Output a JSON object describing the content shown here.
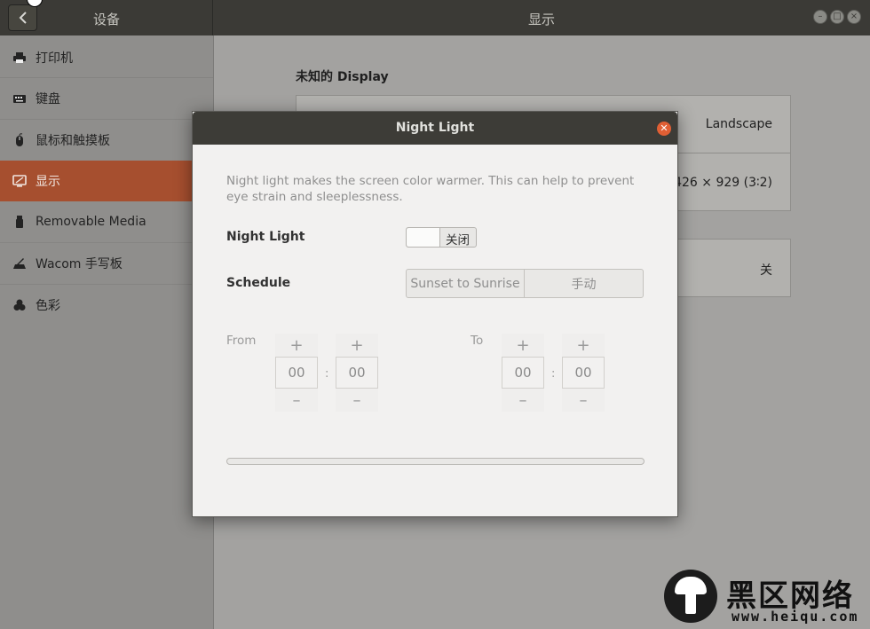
{
  "header": {
    "left_title": "设备",
    "title": "显示",
    "back_icon": "chevron-left-icon",
    "window_controls": [
      "minimize-icon",
      "maximize-icon",
      "close-icon"
    ]
  },
  "sidebar": {
    "items": [
      {
        "label": "打印机",
        "icon": "printer-icon",
        "active": false
      },
      {
        "label": "键盘",
        "icon": "keyboard-icon",
        "active": false
      },
      {
        "label": "鼠标和触摸板",
        "icon": "mouse-icon",
        "active": false
      },
      {
        "label": "显示",
        "icon": "display-icon",
        "active": true
      },
      {
        "label": "Removable Media",
        "icon": "usb-icon",
        "active": false
      },
      {
        "label": "Wacom 手写板",
        "icon": "tablet-icon",
        "active": false
      },
      {
        "label": "色彩",
        "icon": "color-icon",
        "active": false
      }
    ]
  },
  "main": {
    "display_heading": "未知的 Display",
    "orientation_value": "Landscape",
    "resolution_value": "426 × 929 (3∶2)",
    "night_light_value": "关"
  },
  "dialog": {
    "title": "Night Light",
    "description": "Night light makes the screen color warmer. This can help to prevent eye strain and sleeplessness.",
    "night_light_label": "Night Light",
    "switch_label": "关闭",
    "schedule_label": "Schedule",
    "schedule_options": [
      "Sunset to Sunrise",
      "手动"
    ],
    "from_label": "From",
    "to_label": "To",
    "from_hours": "00",
    "from_minutes": "00",
    "to_hours": "00",
    "to_minutes": "00",
    "separator": ":",
    "plus": "+",
    "minus": "–"
  },
  "watermark": {
    "text": "黑区网络",
    "url": "www.heiqu.com"
  },
  "colors": {
    "accent": "#a64f2f",
    "header": "#3b3a36",
    "close_button": "#e05f34"
  }
}
